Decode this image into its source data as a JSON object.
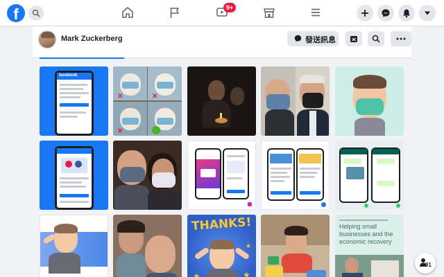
{
  "app": {
    "logo_letter": "f",
    "brand_color": "#1877f2",
    "nav_icons": [
      "home-icon",
      "flag-icon",
      "watch-icon",
      "marketplace-icon",
      "menu-icon"
    ],
    "watch_badge": "9+",
    "right_icons": [
      "plus-icon",
      "messenger-icon",
      "bell-icon",
      "caret-down-icon"
    ]
  },
  "profile": {
    "name": "Mark Zuckerberg",
    "message_button": "發送訊息"
  },
  "tabs": {
    "active_index": 0
  },
  "photos": [
    {
      "id": "photo-1",
      "label": "facebook"
    },
    {
      "id": "photo-2"
    },
    {
      "id": "photo-3"
    },
    {
      "id": "photo-4"
    },
    {
      "id": "photo-5"
    },
    {
      "id": "photo-6"
    },
    {
      "id": "photo-7"
    },
    {
      "id": "photo-8"
    },
    {
      "id": "photo-9"
    },
    {
      "id": "photo-10"
    },
    {
      "id": "photo-11"
    },
    {
      "id": "photo-12"
    },
    {
      "id": "photo-13",
      "text": "THANKS!"
    },
    {
      "id": "photo-14"
    },
    {
      "id": "photo-15",
      "text": "Helping small businesses and the economic recovery"
    }
  ],
  "chat_head": {
    "count": "91"
  }
}
